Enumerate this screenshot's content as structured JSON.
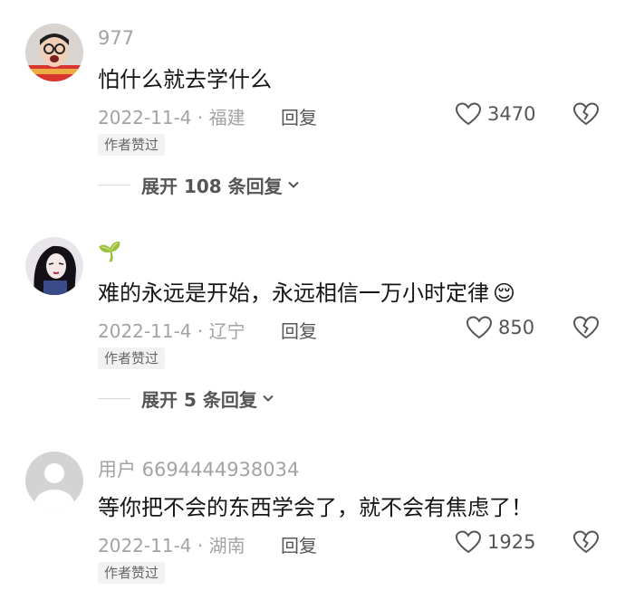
{
  "comments": [
    {
      "username": "977",
      "text": "怕什么就去学什么",
      "date_location": "2022-11-4 · 福建",
      "reply_label": "回复",
      "likes": "3470",
      "badge": "作者赞过",
      "expand_label": "展开 108 条回复"
    },
    {
      "username": "🌱",
      "text": "难的永远是开始，永远相信一万小时定律",
      "emoji": "😌",
      "date_location": "2022-11-4 · 辽宁",
      "reply_label": "回复",
      "likes": "850",
      "badge": "作者赞过",
      "expand_label": "展开 5 条回复"
    },
    {
      "username": "用户 6694444938034",
      "text": "等你把不会的东西学会了，就不会有焦虑了！",
      "date_location": "2022-11-4 · 湖南",
      "reply_label": "回复",
      "likes": "1925",
      "badge": "作者赞过"
    }
  ],
  "icons": {
    "like": "heart-outline-icon",
    "dislike": "broken-heart-icon",
    "expand": "chevron-down-icon"
  },
  "colors": {
    "username": "#a3a3a3",
    "text": "#161616",
    "meta": "#a3a3a3",
    "badge_bg": "#f2f2f2"
  }
}
